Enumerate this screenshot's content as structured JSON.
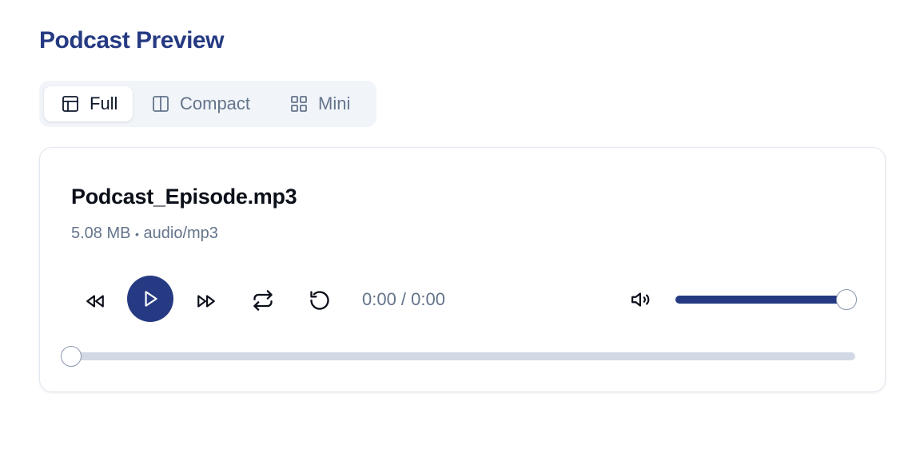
{
  "page": {
    "title": "Podcast Preview"
  },
  "view_tabs": [
    {
      "label": "Full",
      "icon": "layout-icon",
      "active": true
    },
    {
      "label": "Compact",
      "icon": "columns-icon",
      "active": false
    },
    {
      "label": "Mini",
      "icon": "grid-icon",
      "active": false
    }
  ],
  "player": {
    "file_name": "Podcast_Episode.mp3",
    "file_size": "5.08 MB",
    "separator": "•",
    "mime_type": "audio/mp3",
    "time_display": "0:00 / 0:00",
    "volume_fraction": 1.0,
    "progress_fraction": 0.0,
    "controls": [
      "rewind-icon",
      "play-icon",
      "fast-forward-icon",
      "repeat-icon",
      "restart-icon",
      "volume-icon"
    ]
  },
  "colors": {
    "accent": "#253a82",
    "muted_text": "#64748b",
    "track": "#d1d9e4"
  }
}
